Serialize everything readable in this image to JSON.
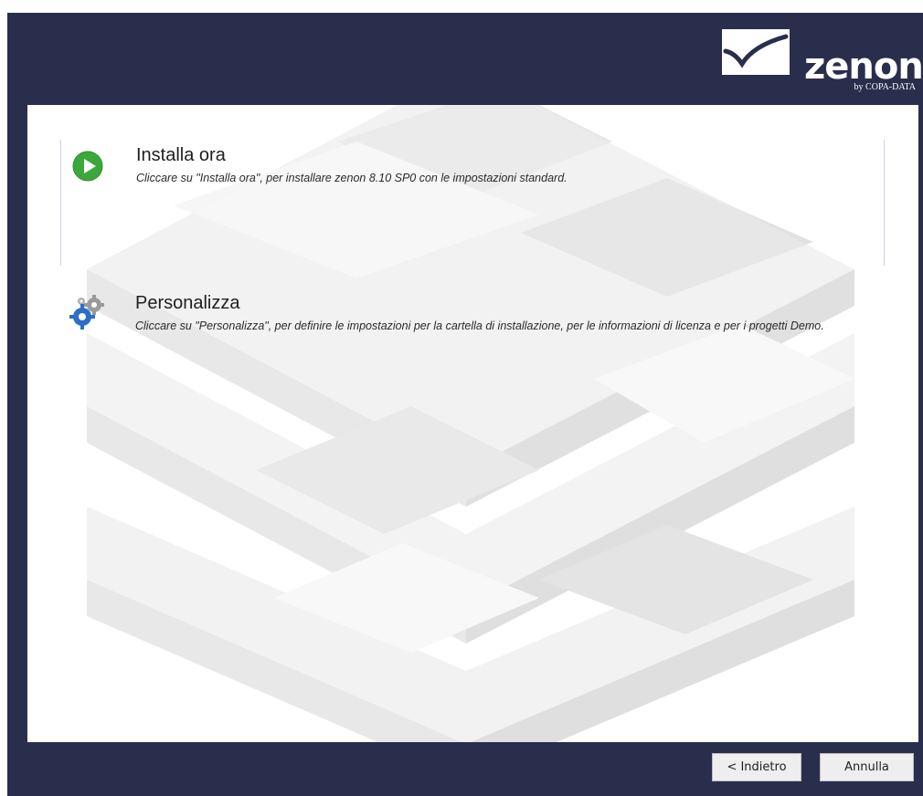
{
  "header": {
    "logo_word": "zenon",
    "logo_sub": "by COPA-DATA",
    "logo_icon": "zenon-checkmark-logo"
  },
  "options": [
    {
      "title": "Installa ora",
      "description": "Cliccare su \"Installa ora\", per installare zenon 8.10 SP0 con le impostazioni standard.",
      "icon": "play-icon",
      "icon_color": "#3aa83a"
    },
    {
      "title": "Personalizza",
      "description": "Cliccare su \"Personalizza\", per definire le impostazioni per la cartella di installazione, per le informazioni di licenza e per i progetti Demo.",
      "icon": "gears-icon",
      "icon_color": "#2a6fc9"
    }
  ],
  "footer": {
    "back_label": "< Indietro",
    "cancel_label": "Annulla"
  },
  "colors": {
    "frame": "#2a2e4d",
    "content": "#ffffff"
  }
}
